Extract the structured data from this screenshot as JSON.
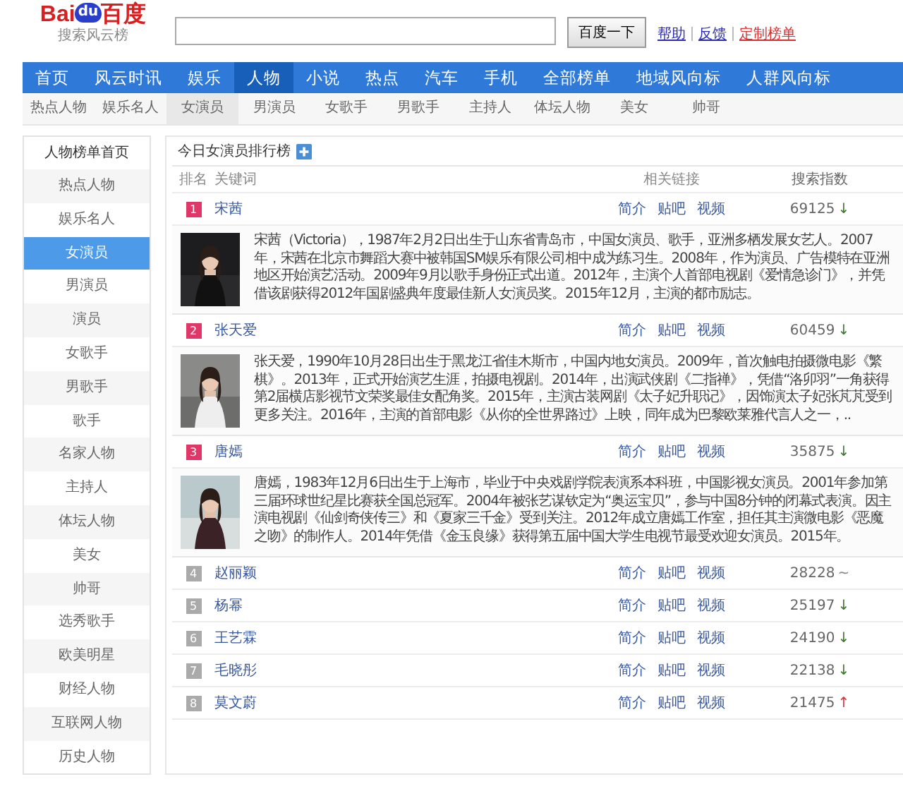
{
  "logo": {
    "text_left": "Bai",
    "text_paw": "du",
    "text_right": "百度",
    "subtitle": "搜索风云榜"
  },
  "search": {
    "button": "百度一下"
  },
  "header_links": [
    {
      "label": "帮助",
      "kind": "normal"
    },
    {
      "label": "反馈",
      "kind": "normal"
    },
    {
      "label": "定制榜单",
      "kind": "highlight"
    }
  ],
  "nav": [
    {
      "label": "首页",
      "selected": false
    },
    {
      "label": "风云时讯",
      "selected": false
    },
    {
      "label": "娱乐",
      "selected": false
    },
    {
      "label": "人物",
      "selected": true
    },
    {
      "label": "小说",
      "selected": false
    },
    {
      "label": "热点",
      "selected": false
    },
    {
      "label": "汽车",
      "selected": false
    },
    {
      "label": "手机",
      "selected": false
    },
    {
      "label": "全部榜单",
      "selected": false
    },
    {
      "label": "地域风向标",
      "selected": false
    },
    {
      "label": "人群风向标",
      "selected": false
    }
  ],
  "subnav": [
    {
      "label": "热点人物",
      "selected": false
    },
    {
      "label": "娱乐名人",
      "selected": false
    },
    {
      "label": "女演员",
      "selected": true
    },
    {
      "label": "男演员",
      "selected": false
    },
    {
      "label": "女歌手",
      "selected": false
    },
    {
      "label": "男歌手",
      "selected": false
    },
    {
      "label": "主持人",
      "selected": false
    },
    {
      "label": "体坛人物",
      "selected": false
    },
    {
      "label": "美女",
      "selected": false
    },
    {
      "label": "帅哥",
      "selected": false
    }
  ],
  "sidebar": {
    "title": "人物榜单首页",
    "items": [
      {
        "label": "热点人物",
        "selected": false
      },
      {
        "label": "娱乐名人",
        "selected": false
      },
      {
        "label": "女演员",
        "selected": true
      },
      {
        "label": "男演员",
        "selected": false
      },
      {
        "label": "演员",
        "selected": false
      },
      {
        "label": "女歌手",
        "selected": false
      },
      {
        "label": "男歌手",
        "selected": false
      },
      {
        "label": "歌手",
        "selected": false
      },
      {
        "label": "名家人物",
        "selected": false
      },
      {
        "label": "主持人",
        "selected": false
      },
      {
        "label": "体坛人物",
        "selected": false
      },
      {
        "label": "美女",
        "selected": false
      },
      {
        "label": "帅哥",
        "selected": false
      },
      {
        "label": "选秀歌手",
        "selected": false
      },
      {
        "label": "欧美明星",
        "selected": false
      },
      {
        "label": "财经人物",
        "selected": false
      },
      {
        "label": "互联网人物",
        "selected": false
      },
      {
        "label": "历史人物",
        "selected": false
      }
    ]
  },
  "table": {
    "title": "今日女演员排行榜",
    "columns": [
      "排名",
      "关键词",
      "相关链接",
      "搜索指数"
    ],
    "rows": [
      {
        "rank": "1",
        "highlight": true,
        "name": "宋茜",
        "links": [
          "简介",
          "贴吧",
          "视频"
        ],
        "index": "69125",
        "trend": {
          "text": "↓",
          "color": "#3a7a2a"
        },
        "description": "宋茜（Victoria），1987年2月2日出生于山东省青岛市，中国女演员、歌手，亚洲多栖发展女艺人。2007年，宋茜在北京市舞蹈大赛中被韩国SM娱乐有限公司相中成为练习生。2008年，作为演员、广告模特在亚洲地区开始演艺活动。2009年9月以歌手身份正式出道。2012年，主演个人首部电视剧《爱情急诊门》，并凭借该剧获得2012年国剧盛典年度最佳新人女演员奖。2015年12月，主演的都市励志。",
        "photo": {
          "kind": "picture"
        }
      },
      {
        "rank": "2",
        "highlight": true,
        "name": "张天爱",
        "links": [
          "简介",
          "贴吧",
          "视频"
        ],
        "index": "60459",
        "trend": {
          "text": "↓",
          "color": "#3a7a2a"
        },
        "description": "张天爱，1990年10月28日出生于黑龙江省佳木斯市，中国内地女演员。2009年，首次触电拍摄微电影《繁棋》。2013年，正式开始演艺生涯，拍摄电视剧。2014年，出演武侠剧《二指禅》，凭借“洛卯羽”一角获得第2届横店影视节文荣奖最佳女配角奖。2015年，主演古装网剧《太子妃升职记》，因饰演太子妃张芃芃受到更多关注。2016年，主演的首部电影《从你的全世界路过》上映，同年成为巴黎欧莱雅代言人之一，..",
        "photo": {
          "kind": "picture"
        }
      },
      {
        "rank": "3",
        "highlight": true,
        "name": "唐嫣",
        "links": [
          "简介",
          "贴吧",
          "视频"
        ],
        "index": "35875",
        "trend": {
          "text": "↓",
          "color": "#3a7a2a"
        },
        "description": "唐嫣，1983年12月6日出生于上海市，毕业于中央戏剧学院表演系本科班，中国影视女演员。2001年参加第三届环球世纪星比赛获全国总冠军。2004年被张艺谋钦定为“奥运宝贝”，参与中国8分钟的闭幕式表演。因主演电视剧《仙剑奇侠传三》和《夏家三千金》受到关注。2012年成立唐嫣工作室，担任其主演微电影《恶魔之吻》的制作人。2014年凭借《金玉良缘》获得第五届中国大学生电视节最受欢迎女演员。2015年。",
        "photo": {
          "kind": "picture"
        }
      },
      {
        "rank": "4",
        "highlight": false,
        "name": "赵丽颖",
        "links": [
          "简介",
          "贴吧",
          "视频"
        ],
        "index": "28228",
        "trend": {
          "text": "~",
          "color": "#888888"
        }
      },
      {
        "rank": "5",
        "highlight": false,
        "name": "杨幂",
        "links": [
          "简介",
          "贴吧",
          "视频"
        ],
        "index": "25197",
        "trend": {
          "text": "↓",
          "color": "#3a7a2a"
        }
      },
      {
        "rank": "6",
        "highlight": false,
        "name": "王艺霖",
        "links": [
          "简介",
          "贴吧",
          "视频"
        ],
        "index": "24190",
        "trend": {
          "text": "↓",
          "color": "#3a7a2a"
        }
      },
      {
        "rank": "7",
        "highlight": false,
        "name": "毛晓彤",
        "links": [
          "简介",
          "贴吧",
          "视频"
        ],
        "index": "22138",
        "trend": {
          "text": "↓",
          "color": "#3a7a2a"
        }
      },
      {
        "rank": "8",
        "highlight": false,
        "name": "莫文蔚",
        "links": [
          "简介",
          "贴吧",
          "视频"
        ],
        "index": "21475",
        "trend": {
          "text": "↑",
          "color": "#e03030"
        }
      }
    ]
  }
}
